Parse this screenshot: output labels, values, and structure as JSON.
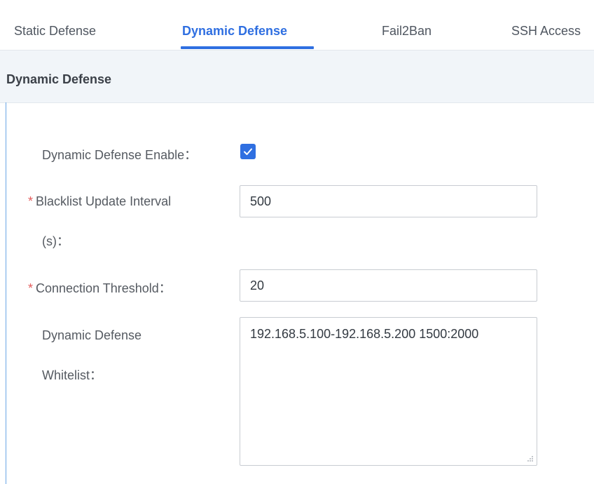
{
  "tabs": [
    {
      "label": "Static Defense",
      "active": false
    },
    {
      "label": "Dynamic Defense",
      "active": true
    },
    {
      "label": "Fail2Ban",
      "active": false
    },
    {
      "label": "SSH Access",
      "active": false
    }
  ],
  "section": {
    "title": "Dynamic Defense"
  },
  "form": {
    "enable": {
      "label": "Dynamic Defense Enable：",
      "checked": true
    },
    "blacklist_interval": {
      "required_mark": "*",
      "label_line1": "Blacklist Update Interval",
      "label_line2": "(s)：",
      "value": "500"
    },
    "connection_threshold": {
      "required_mark": "*",
      "label": "Connection Threshold：",
      "value": "20"
    },
    "whitelist": {
      "label_line1": "Dynamic Defense",
      "label_line2": "Whitelist：",
      "value": "192.168.5.100-192.168.5.200 1500:2000"
    }
  },
  "colors": {
    "accent": "#2f6fe1",
    "required": "#e35d5d",
    "header_bg": "#f1f5f9"
  },
  "icons": {
    "checkbox": "checkmark-icon",
    "resize": "resize-grip-icon"
  }
}
